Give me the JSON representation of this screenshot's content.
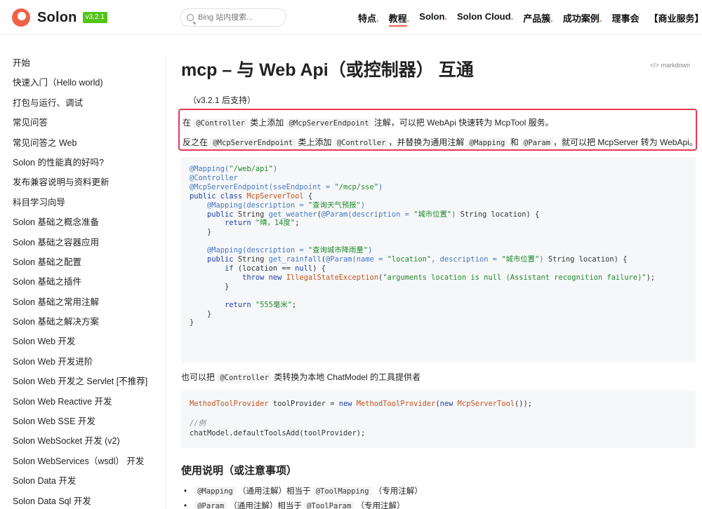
{
  "header": {
    "logo_text": "Solon",
    "version": "v3.2.1",
    "search_placeholder": "Bing 站内搜索...",
    "nav": [
      {
        "label": "特点",
        "dot": ".",
        "active": false
      },
      {
        "label": "教程",
        "dot": ".",
        "active": true
      },
      {
        "label": "Solon",
        "dot": ".",
        "active": false
      },
      {
        "label": "Solon Cloud",
        "dot": ".",
        "active": false
      },
      {
        "label": "产品簇",
        "dot": ".",
        "active": false
      },
      {
        "label": "成功案例",
        "dot": ".",
        "active": false
      },
      {
        "label": "理事会",
        "dot": "",
        "active": false
      },
      {
        "label": "【商业服务】",
        "dot": "",
        "active": false
      }
    ]
  },
  "sidebar": {
    "items": [
      "开始",
      "快速入门（Hello world)",
      "打包与运行、调试",
      "常见问答",
      "常见问答之 Web",
      "Solon 的性能真的好吗?",
      "发布兼容说明与资料更新",
      "科目学习向导",
      "Solon 基础之概念准备",
      "Solon 基础之容器应用",
      "Solon 基础之配置",
      "Solon 基础之插件",
      "Solon 基础之常用注解",
      "Solon 基础之解决方案",
      "Solon Web 开发",
      "Solon Web 开发进阶",
      "Solon Web 开发之 Servlet [不推荐]",
      "Solon Web Reactive 开发",
      "Solon Web SSE 开发",
      "Solon WebSocket 开发 (v2)",
      "Solon WebServices（wsdl） 开发",
      "Solon Data 开发",
      "Solon Data Sql 开发"
    ]
  },
  "main": {
    "title": "mcp – 与 Web Api（或控制器） 互通",
    "markdown_link": "</> markdown",
    "since": "（v3.2.1 后支持）",
    "highlight": {
      "line1": {
        "p1": "在",
        "c1": "@Controller",
        "p2": "类上添加",
        "c2": "@McpServerEndpoint",
        "p3": "注解，可以把 WebApi 快速转为 McpTool 服务。"
      },
      "line2": {
        "p1": "反之在",
        "c1": "@McpServerEndpoint",
        "p2": "类上添加",
        "c2": "@Controller",
        "p3": "，并替换为通用注解",
        "c3": "@Mapping",
        "p4": "和",
        "c4": "@Param",
        "p5": "，就可以把 McpServer 转为 WebApi。"
      }
    },
    "paragraph": {
      "p1": "也可以把",
      "c1": "@Controller",
      "p2": "类转换为本地 ChatModel 的工具提供者"
    },
    "section_title": "使用说明（或注意事项）",
    "bullets": [
      {
        "c1": "@Mapping",
        "p1": "（通用注解）相当于",
        "c2": "@ToolMapping",
        "p2": "（专用注解）"
      },
      {
        "c1": "@Param",
        "p1": "（通用注解）相当于",
        "c2": "@ToolParam",
        "p2": "（专用注解）"
      }
    ]
  }
}
